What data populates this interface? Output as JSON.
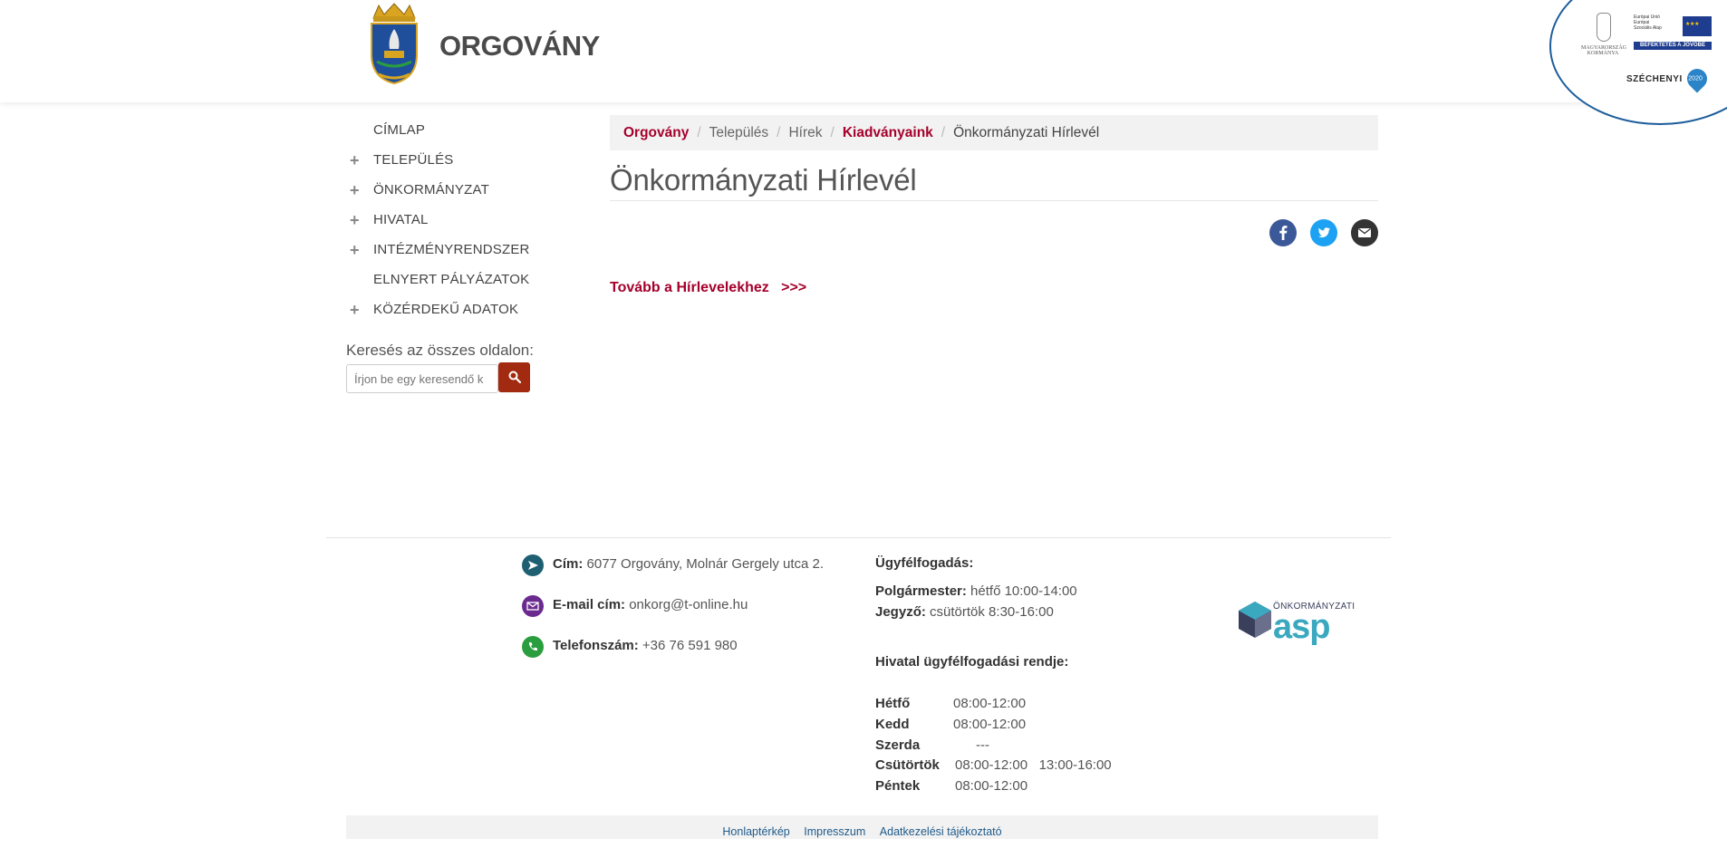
{
  "header": {
    "site_title": "ORGOVÁNY",
    "eu_logo": {
      "hu_gov": "MAGYARORSZÁG KORMÁNYA",
      "eu_text": "Európai Unió Európai Szociális Alap",
      "band": "BEFEKTETÉS A JÖVŐBE",
      "program": "SZÉCHENYI",
      "year": "2020"
    }
  },
  "nav": {
    "items": [
      {
        "label": "CÍMLAP",
        "expandable": false
      },
      {
        "label": "TELEPÜLÉS",
        "expandable": true
      },
      {
        "label": "ÖNKORMÁNYZAT",
        "expandable": true
      },
      {
        "label": "HIVATAL",
        "expandable": true
      },
      {
        "label": "INTÉZMÉNYRENDSZER",
        "expandable": true
      },
      {
        "label": "ELNYERT PÁLYÁZATOK",
        "expandable": false
      },
      {
        "label": "KÖZÉRDEKŰ ADATOK",
        "expandable": true
      }
    ]
  },
  "search": {
    "label": "Keresés az összes oldalon:",
    "placeholder": "Írjon be egy keresendő k"
  },
  "breadcrumb": {
    "items": [
      "Orgovány",
      "Település",
      "Hírek",
      "Kiadványaink",
      "Önkormányzati Hírlevél"
    ]
  },
  "main": {
    "title": "Önkormányzati Hírlevél",
    "more_link": "Tovább a Hírlevelekhez   >>>"
  },
  "footer": {
    "contact": {
      "address_label": "Cím:",
      "address": "6077 Orgovány, Molnár Gergely utca 2.",
      "email_label": "E-mail cím:",
      "email": "onkorg@t-online.hu",
      "phone_label": "Telefonszám:",
      "phone": "+36 76 591 980"
    },
    "hours": {
      "heading": "Ügyfélfogadás:",
      "mayor_label": "Polgármester:",
      "mayor": "hétfő 10:00-14:00",
      "notary_label": "Jegyző:",
      "notary": "csütörtök 8:30-16:00",
      "office_heading": "Hivatal ügyfélfogadási rendje:",
      "days": [
        {
          "day": "Hétfő",
          "time": "08:00-12:00"
        },
        {
          "day": "Kedd",
          "time": "08:00-12:00"
        },
        {
          "day": "Szerda",
          "time": "---"
        },
        {
          "day": "Csütörtök",
          "time": "08:00-12:00   13:00-16:00"
        },
        {
          "day": "Péntek",
          "time": "08:00-12:00"
        }
      ]
    },
    "asp_logo": {
      "small": "ÖNKORMÁNYZATI",
      "big": "asp"
    },
    "links": [
      "Honlaptérkép",
      "Impresszum",
      "Adatkezelési tájékoztató"
    ]
  }
}
